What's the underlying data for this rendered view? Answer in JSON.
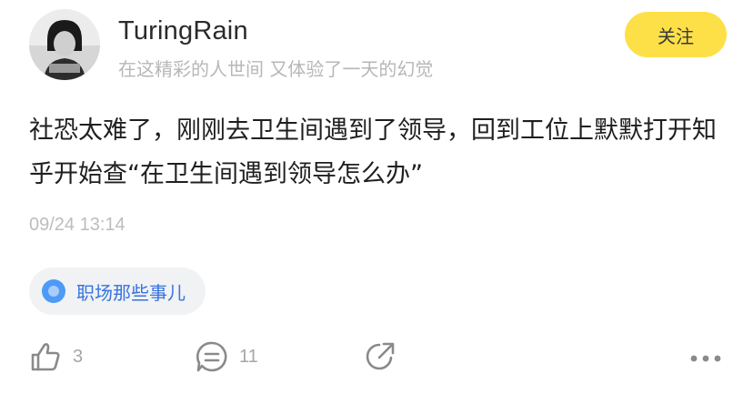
{
  "post": {
    "author": {
      "name": "TuringRain",
      "bio": "在这精彩的人世间   又体验了一天的幻觉"
    },
    "follow_label": "关注",
    "content": "社恐太难了，刚刚去卫生间遇到了领导，回到工位上默默打开知乎开始查“在卫生间遇到领导怎么办”",
    "timestamp": "09/24 13:14",
    "topic": "职场那些事儿",
    "actions": {
      "likes": "3",
      "comments": "11"
    }
  },
  "colors": {
    "follow_button": "#fde047",
    "topic_text": "#3773e0",
    "topic_icon": "#4d9bf7"
  },
  "icons": [
    "avatar-photo",
    "thumbs-up-icon",
    "comment-icon",
    "share-icon",
    "more-icon"
  ]
}
